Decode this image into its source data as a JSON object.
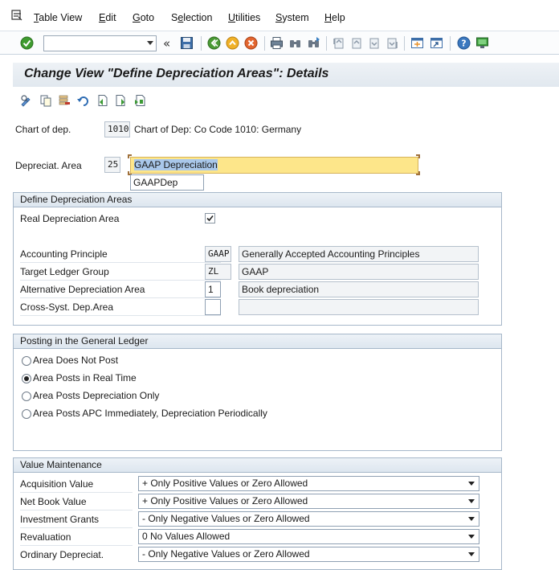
{
  "menubar": {
    "items": [
      {
        "label": "Table View",
        "u": "T",
        "rest": "able View"
      },
      {
        "label": "Edit",
        "u": "E",
        "rest": "dit"
      },
      {
        "label": "Goto",
        "u": "G",
        "rest": "oto"
      },
      {
        "label": "Selection",
        "u": "",
        "rest": ""
      },
      {
        "label": "Utilities",
        "u": "U",
        "rest": "tilities"
      },
      {
        "label": "System",
        "u": "S",
        "rest": "ystem"
      },
      {
        "label": "Help",
        "u": "H",
        "rest": "elp"
      }
    ]
  },
  "toolbar": {
    "command_field": "",
    "back_glyph": "«",
    "icons": [
      "enter-icon",
      "save-icon",
      "back-icon",
      "exit-icon",
      "cancel-icon",
      "print-icon",
      "find-icon",
      "find-next-icon",
      "first-page-icon",
      "previous-page-icon",
      "next-page-icon",
      "last-page-icon",
      "create-session-icon",
      "shortcut-icon",
      "help-icon",
      "customize-layout-icon"
    ]
  },
  "title": "Change View \"Define Depreciation Areas\": Details",
  "header": {
    "chart_label": "Chart of dep.",
    "chart_value": "1010",
    "chart_desc": "Chart of Dep: Co Code 1010: Germany",
    "area_label": "Depreciat. Area",
    "area_value": "25",
    "area_desc": "GAAP Depreciation",
    "area_short": "GAAPDep"
  },
  "define_group": {
    "title": "Define Depreciation Areas",
    "real_label": "Real Depreciation Area",
    "real_checked": true,
    "rows": [
      {
        "label": "Accounting Principle",
        "value": "GAAP",
        "desc": "Generally Accepted Accounting Principles"
      },
      {
        "label": "Target Ledger Group",
        "value": "ZL",
        "desc": "GAAP"
      },
      {
        "label": "Alternative Depreciation Area",
        "value": "1",
        "desc": "Book depreciation"
      },
      {
        "label": "Cross-Syst. Dep.Area",
        "value": "",
        "desc": ""
      }
    ]
  },
  "posting_group": {
    "title": "Posting in the General Ledger",
    "options": [
      {
        "label": "Area Does Not Post",
        "selected": false
      },
      {
        "label": "Area Posts in Real Time",
        "selected": true
      },
      {
        "label": "Area Posts Depreciation Only",
        "selected": false
      },
      {
        "label": "Area Posts APC Immediately, Depreciation Periodically",
        "selected": false
      }
    ]
  },
  "value_group": {
    "title": "Value Maintenance",
    "rows": [
      {
        "label": "Acquisition Value",
        "value": "+ Only Positive Values or Zero Allowed"
      },
      {
        "label": "Net Book Value",
        "value": "+ Only Positive Values or Zero Allowed"
      },
      {
        "label": "Investment Grants",
        "value": "- Only Negative Values or Zero Allowed"
      },
      {
        "label": "Revaluation",
        "value": "0 No Values Allowed"
      },
      {
        "label": "Ordinary Depreciat.",
        "value": "- Only Negative Values or Zero Allowed"
      }
    ]
  }
}
